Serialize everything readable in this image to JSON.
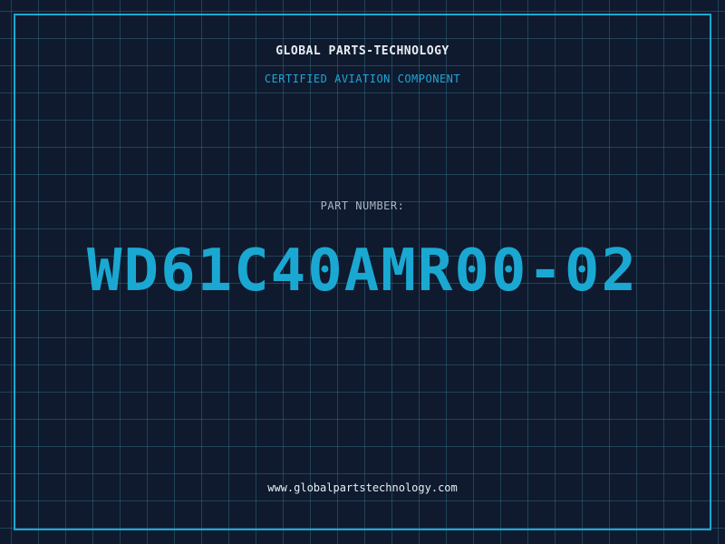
{
  "header": {
    "company_name": "GLOBAL PARTS-TECHNOLOGY",
    "tagline": "CERTIFIED AVIATION COMPONENT"
  },
  "part": {
    "label": "PART NUMBER:",
    "number": "WD61C40AMR00-02"
  },
  "footer": {
    "website": "www.globalpartstechnology.com"
  },
  "colors": {
    "background": "#0f1a2e",
    "accent": "#1aa8d2",
    "text": "#e8eef5",
    "muted": "#aab6c4"
  }
}
